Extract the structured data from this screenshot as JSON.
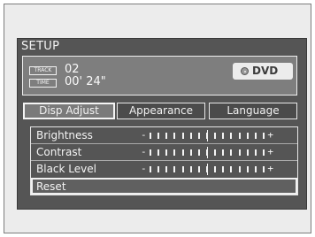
{
  "screen": {
    "title": "SETUP"
  },
  "info": {
    "track_tag": "TRACK",
    "track_value": "02",
    "time_tag": "TIME",
    "time_value": "00' 24\"",
    "source_label": "DVD",
    "source_icon": "disc-icon"
  },
  "tabs": [
    {
      "label": "Disp Adjust",
      "active": true
    },
    {
      "label": "Appearance",
      "active": false
    },
    {
      "label": "Language",
      "active": false
    }
  ],
  "adjust_items": [
    {
      "label": "Brightness",
      "minus": "-",
      "plus": "+",
      "level": 0.5,
      "segments": 15
    },
    {
      "label": "Contrast",
      "minus": "-",
      "plus": "+",
      "level": 0.5,
      "segments": 15
    },
    {
      "label": "Black Level",
      "minus": "-",
      "plus": "+",
      "level": 0.5,
      "segments": 15
    }
  ],
  "reset": {
    "label": "Reset",
    "selected": true
  }
}
